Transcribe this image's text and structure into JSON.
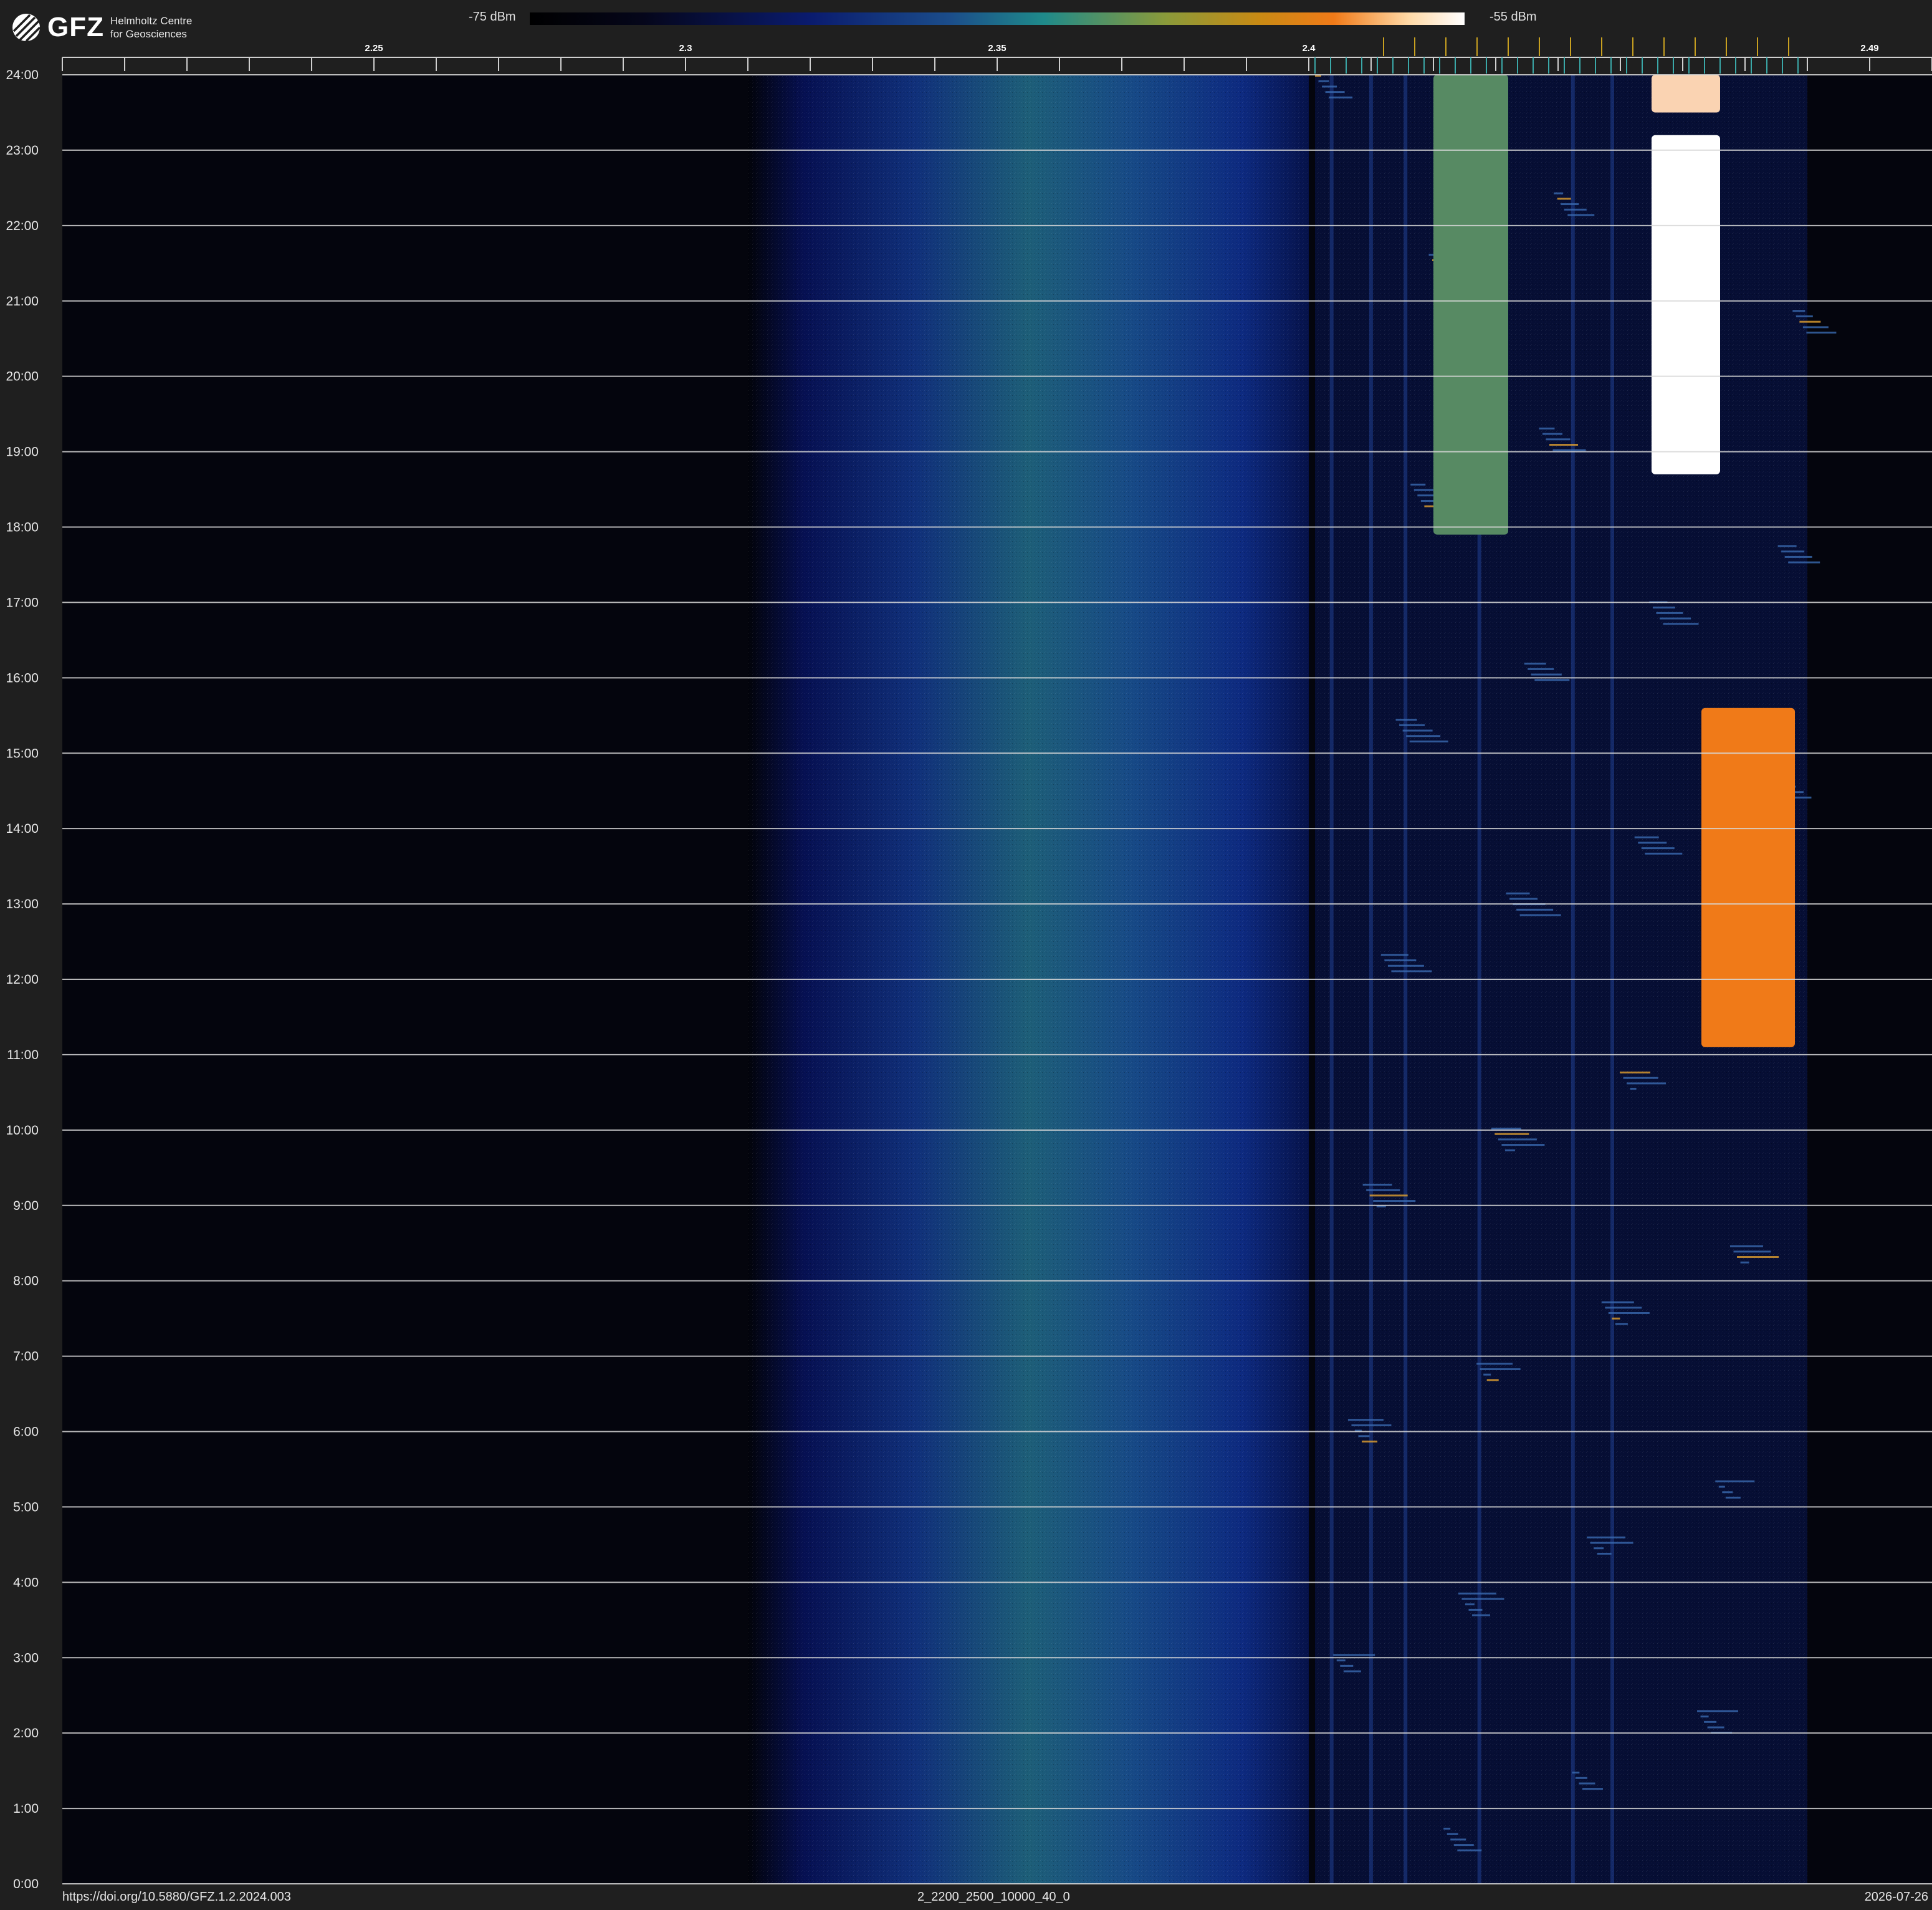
{
  "brand": {
    "logo_text": "GFZ",
    "org_line1": "Helmholtz Centre",
    "org_line2": "for Geosciences",
    "logo_icon": "gfz-logo-icon"
  },
  "colorbar": {
    "min_label": "-75 dBm",
    "max_label": "-55 dBm",
    "colormap": [
      "#000000",
      "#0a1b6e",
      "#1f8a8a",
      "#c88a14",
      "#f07a18",
      "#ffffff"
    ]
  },
  "chart_data": {
    "type": "heatmap",
    "title": "",
    "xlabel": "",
    "ylabel": "",
    "x_range": [
      2.2,
      2.5
    ],
    "y_range": [
      0,
      24
    ],
    "value_range_dbm": [
      -75,
      -55
    ],
    "x_ticks": [
      {
        "value": 2.25,
        "label": "2.25"
      },
      {
        "value": 2.3,
        "label": "2.3"
      },
      {
        "value": 2.35,
        "label": "2.35"
      },
      {
        "value": 2.4,
        "label": "2.4"
      },
      {
        "value": 2.49,
        "label": "2.49"
      }
    ],
    "y_ticks": [
      "0:00",
      "1:00",
      "2:00",
      "3:00",
      "4:00",
      "5:00",
      "6:00",
      "7:00",
      "8:00",
      "9:00",
      "10:00",
      "11:00",
      "12:00",
      "13:00",
      "14:00",
      "15:00",
      "16:00",
      "17:00",
      "18:00",
      "19:00",
      "20:00",
      "21:00",
      "22:00",
      "23:00",
      "24:00"
    ],
    "grid": true,
    "features": [
      {
        "kind": "broad-band-noise",
        "f_start": 2.31,
        "f_end": 2.4,
        "t_start": 0,
        "t_end": 24,
        "peak_dbm": -67
      },
      {
        "kind": "sparse-signals",
        "f_start": 2.401,
        "f_end": 2.48,
        "t_start": 0,
        "t_end": 24,
        "peak_dbm": -62
      },
      {
        "kind": "strong-signal",
        "f_start": 2.455,
        "f_end": 2.466,
        "t_start": 18.7,
        "t_end": 23.2,
        "peak_dbm": -55
      },
      {
        "kind": "strong-signal",
        "f_start": 2.455,
        "f_end": 2.466,
        "t_start": 23.5,
        "t_end": 24,
        "peak_dbm": -56
      },
      {
        "kind": "strong-signal",
        "f_start": 2.463,
        "f_end": 2.478,
        "t_start": 11.1,
        "t_end": 15.6,
        "peak_dbm": -58
      },
      {
        "kind": "strong-signal",
        "f_start": 2.42,
        "f_end": 2.432,
        "t_start": 17.9,
        "t_end": 24,
        "peak_dbm": -63
      }
    ]
  },
  "footer": {
    "doi": "https://doi.org/10.5880/GFZ.1.2.2024.003",
    "dataset_id": "2_2200_2500_10000_40_0",
    "date": "2026-07-26"
  }
}
